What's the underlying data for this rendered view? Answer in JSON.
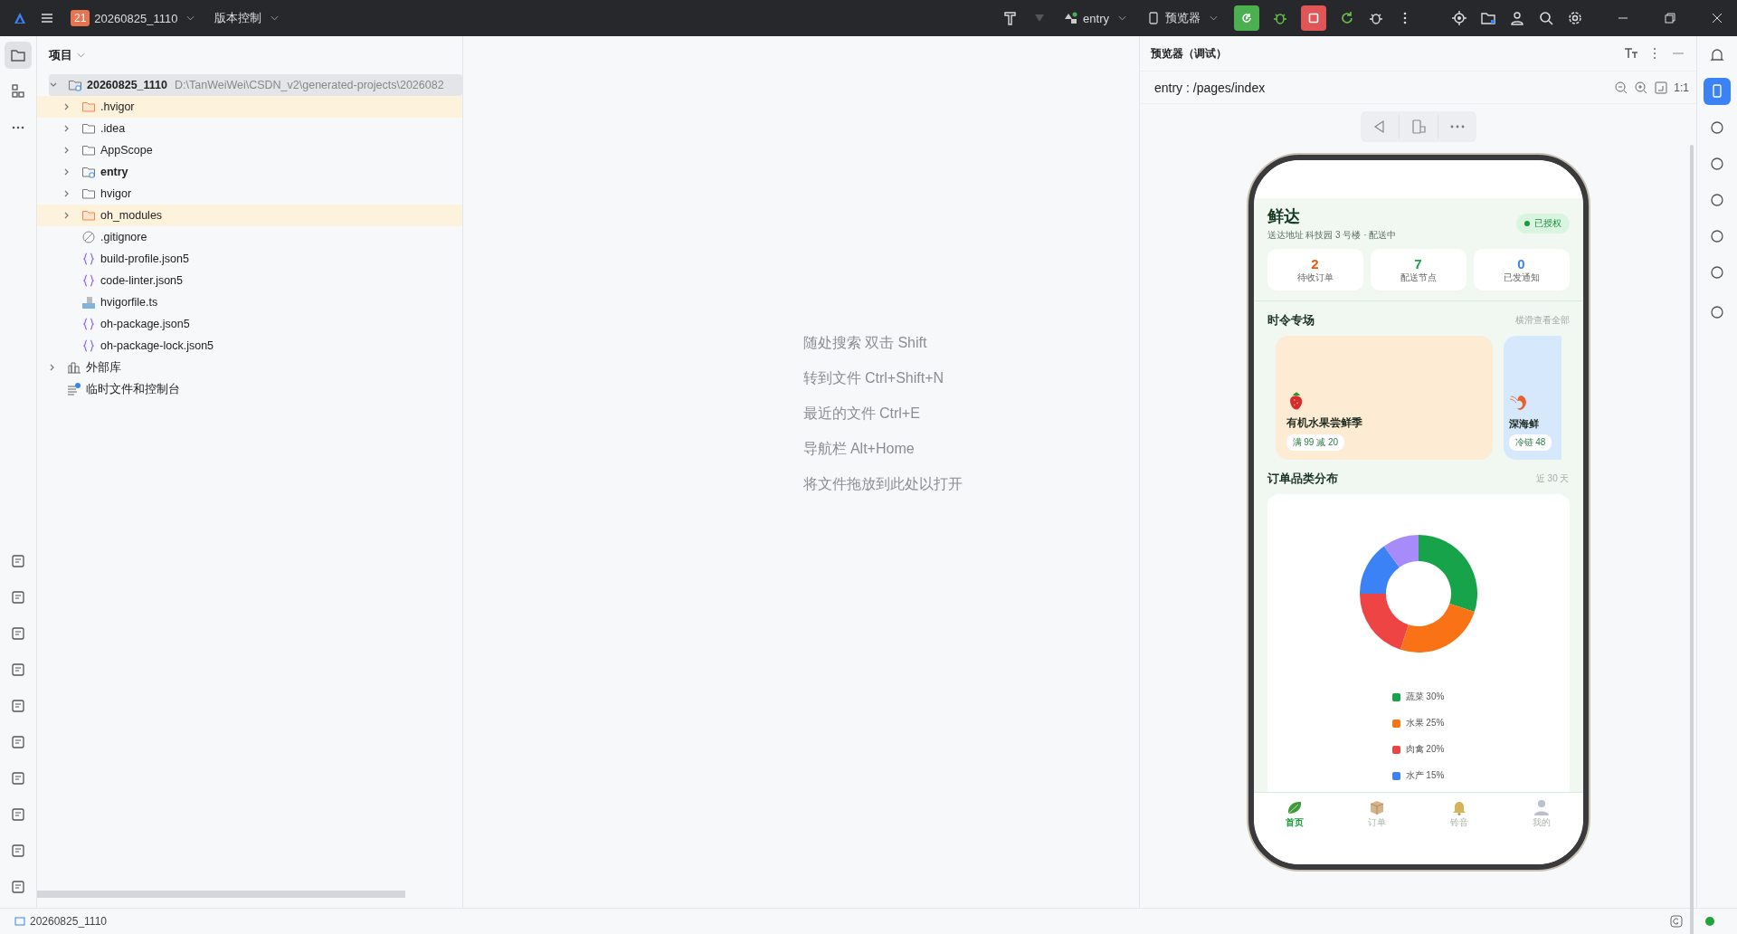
{
  "title_bar": {
    "badge": "21",
    "project": "20260825_1110",
    "vcs": "版本控制",
    "module": "entry",
    "device": "预览器"
  },
  "left_toolbar": [
    {
      "selected": true
    },
    {
      "selected": false
    },
    {
      "selected": false
    }
  ],
  "project_panel": {
    "title": "项目",
    "tree": [
      {
        "label": "20260825_1110",
        "path": "D:\\TanWeiWei\\CSDN_v2\\generated-projects\\2026082",
        "kind": "module",
        "expanded": true,
        "selected": true,
        "excluded": false,
        "children": [
          {
            "label": ".hvigor",
            "kind": "folder",
            "expanded": false,
            "selected": false,
            "excluded": true
          },
          {
            "label": ".idea",
            "kind": "folder",
            "expanded": false,
            "selected": false,
            "excluded": false
          },
          {
            "label": "AppScope",
            "kind": "folder",
            "expanded": false,
            "selected": false,
            "excluded": false
          },
          {
            "label": "entry",
            "kind": "module",
            "expanded": false,
            "selected": false,
            "excluded": false
          },
          {
            "label": "hvigor",
            "kind": "folder",
            "expanded": false,
            "selected": false,
            "excluded": false
          },
          {
            "label": "oh_modules",
            "kind": "folder",
            "expanded": false,
            "selected": false,
            "excluded": true
          },
          {
            "label": ".gitignore",
            "kind": "ignore",
            "selected": false,
            "excluded": false
          },
          {
            "label": "build-profile.json5",
            "kind": "json",
            "selected": false,
            "excluded": false
          },
          {
            "label": "code-linter.json5",
            "kind": "json",
            "selected": false,
            "excluded": false
          },
          {
            "label": "hvigorfile.ts",
            "kind": "ts",
            "selected": false,
            "excluded": false
          },
          {
            "label": "oh-package.json5",
            "kind": "json",
            "selected": false,
            "excluded": false
          },
          {
            "label": "oh-package-lock.json5",
            "kind": "json",
            "selected": false,
            "excluded": false
          }
        ]
      },
      {
        "label": "外部库",
        "kind": "library",
        "expanded": false,
        "selected": false,
        "excluded": false
      },
      {
        "label": "临时文件和控制台",
        "kind": "scratch",
        "selected": false,
        "excluded": false
      }
    ]
  },
  "editor_hints": [
    "随处搜索 双击 Shift",
    "转到文件 Ctrl+Shift+N",
    "最近的文件 Ctrl+E",
    "导航栏 Alt+Home",
    "将文件拖放到此处以打开"
  ],
  "preview": {
    "title": "预览器（调试）",
    "route": "entry : /pages/index",
    "zoom_label": "1:1",
    "app": {
      "brand": "鲜达",
      "address": "送达地址 科技园 3 号楼 · 配送中",
      "auth": "已授权",
      "stats": [
        {
          "value": "2",
          "label": "待收订单",
          "color": "#e8590c"
        },
        {
          "value": "7",
          "label": "配送节点",
          "color": "#16a34a"
        },
        {
          "value": "0",
          "label": "已发通知",
          "color": "#3b82f6"
        }
      ],
      "promo_section": {
        "title": "时令专场",
        "link": "横滑查看全部",
        "cards": [
          {
            "kind": "strawberry",
            "title": "有机水果尝鲜季",
            "tag": "满 99 减 20",
            "color": "#fdebd3"
          },
          {
            "kind": "shrimp",
            "title": "深海鲜",
            "tag": "冷链 48",
            "color": "#d6e8fb"
          }
        ]
      },
      "chart_section": {
        "title": "订单品类分布",
        "range": "近 30 天",
        "chart_data": {
          "type": "donut",
          "values": [
            30,
            25,
            20,
            15,
            10
          ],
          "colors": [
            "#16a34a",
            "#f97316",
            "#ef4444",
            "#3b82f6",
            "#a78bfa"
          ]
        },
        "legend": [
          {
            "label": "蔬菜 30%",
            "color": "#16a34a"
          },
          {
            "label": "水果 25%",
            "color": "#f97316"
          },
          {
            "label": "肉禽 20%",
            "color": "#ef4444"
          },
          {
            "label": "水产 15%",
            "color": "#3b82f6"
          }
        ]
      },
      "tabs": [
        {
          "kind": "leaf",
          "label": "首页",
          "selected": true
        },
        {
          "kind": "box",
          "label": "订单",
          "selected": false
        },
        {
          "kind": "bell",
          "label": "铃音",
          "selected": false
        },
        {
          "kind": "person",
          "label": "我的",
          "selected": false
        }
      ]
    }
  },
  "right_toolbar": [
    {
      "selected": false
    },
    {
      "selected": true
    },
    {
      "selected": false
    },
    {
      "selected": false
    },
    {
      "selected": false
    },
    {
      "selected": false
    },
    {
      "selected": false
    },
    {
      "selected": false
    }
  ],
  "status_bar": {
    "project": "20260825_1110"
  }
}
